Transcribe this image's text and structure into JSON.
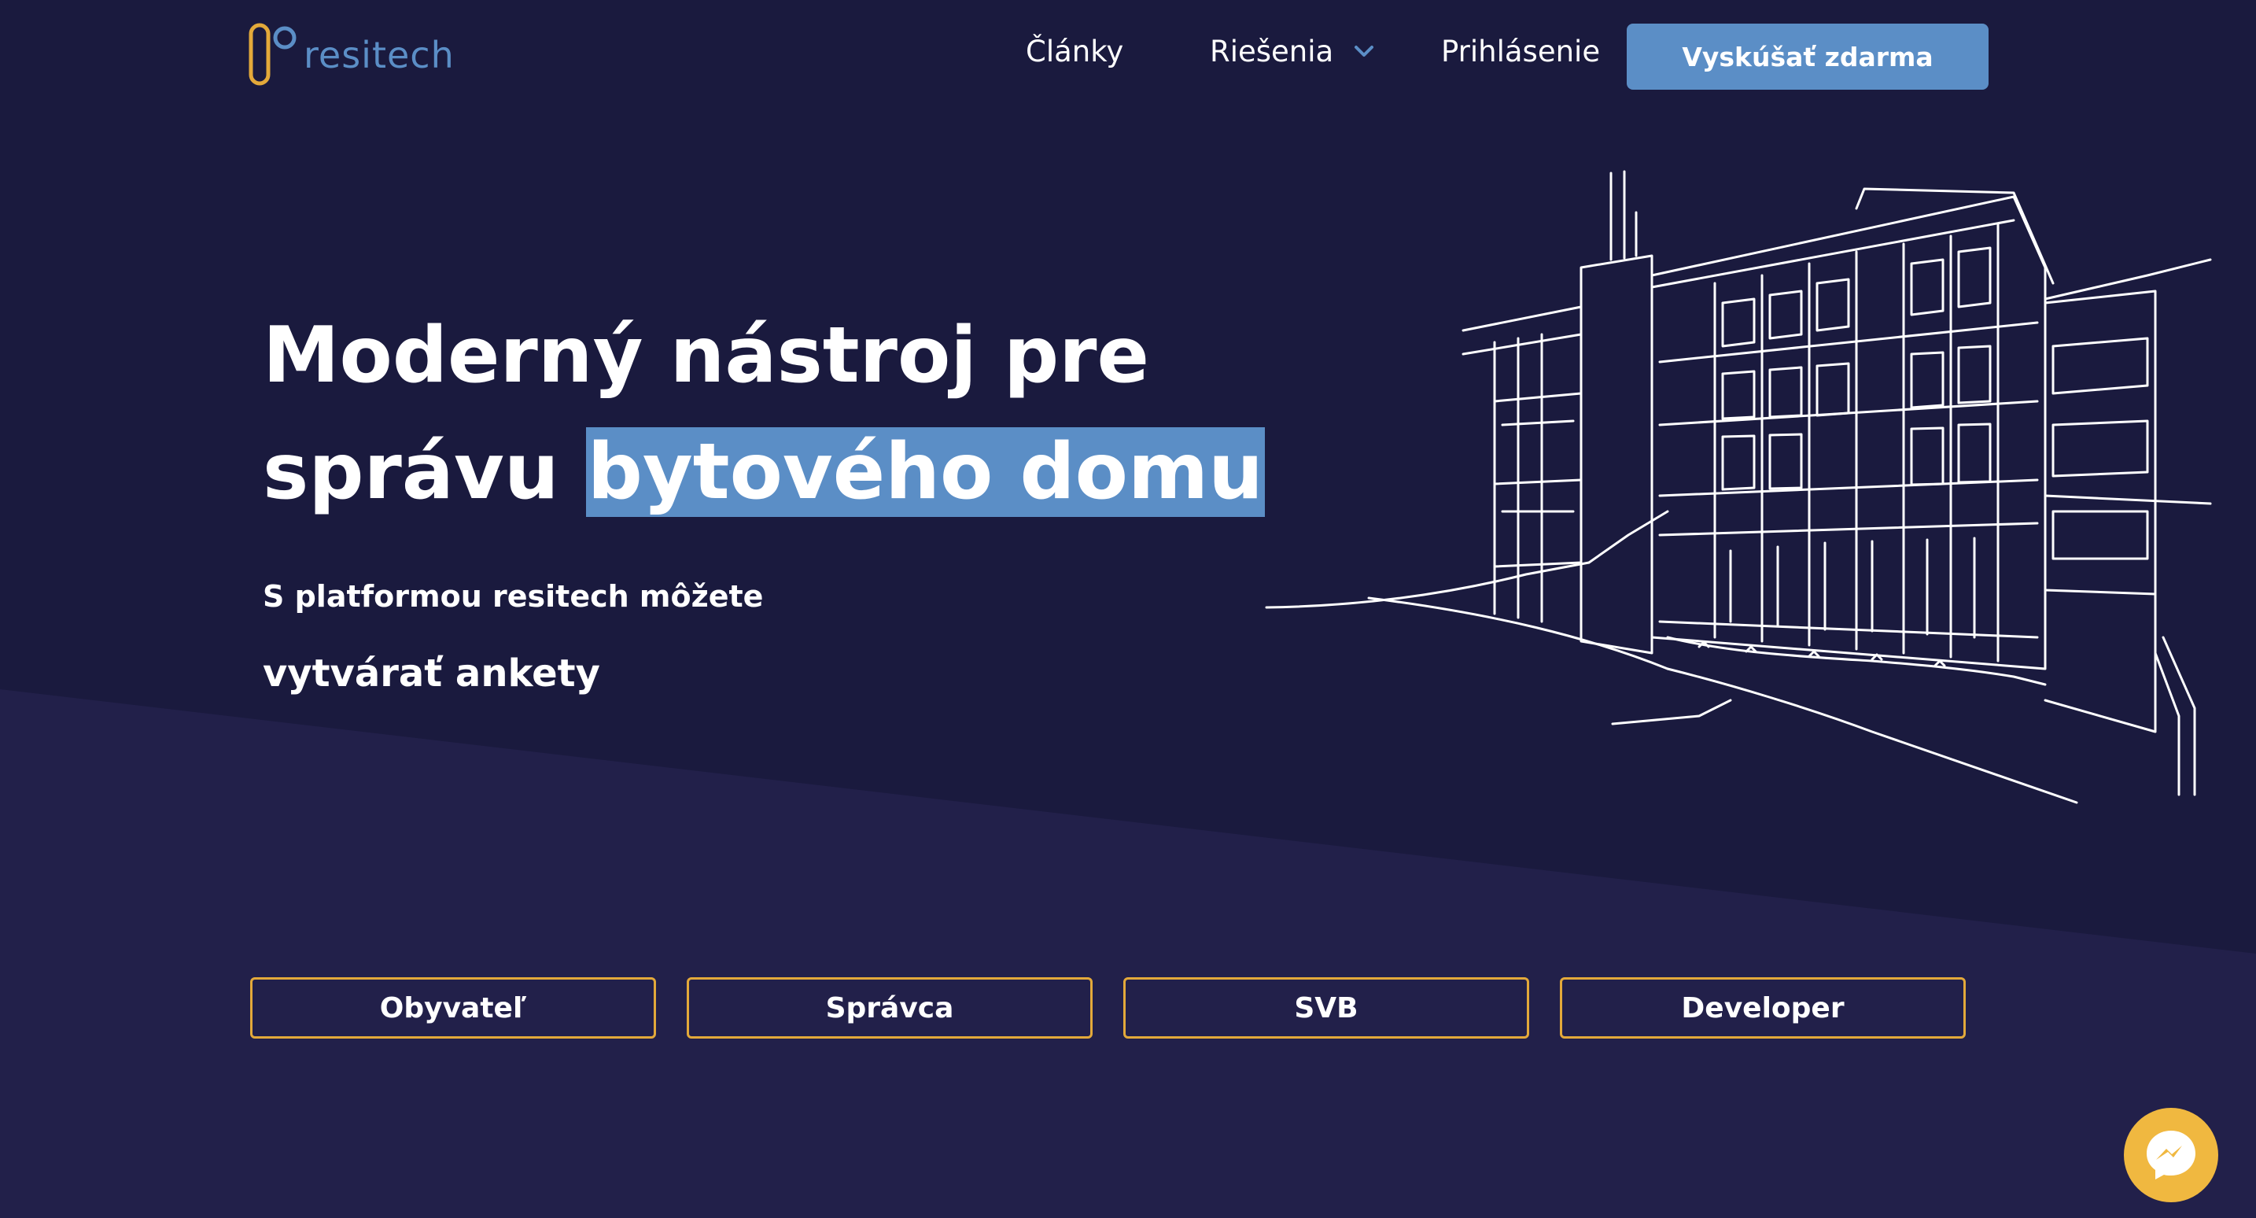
{
  "brand": {
    "name": "resitech",
    "accent": "#5b8ec6",
    "logo_accent": "#e3a93a"
  },
  "nav": {
    "articles": "Články",
    "solutions": "Riešenia",
    "login": "Prihlásenie",
    "cta": "Vyskúšať zdarma"
  },
  "hero": {
    "title_line1": "Moderný nástroj pre",
    "title_line2_plain": "správu ",
    "title_line2_highlight": "bytového domu",
    "subtitle": "S platformou resitech môžete",
    "feature": "vytvárať ankety"
  },
  "audiences": [
    "Obyvateľ",
    "Správca",
    "SVB",
    "Developer"
  ],
  "colors": {
    "background": "#1a1a3e",
    "background_lower": "#22204a",
    "button_border": "#e3a93a",
    "messenger": "#f0b840"
  },
  "icons": {
    "dropdown": "chevron-down-icon",
    "chat": "messenger-icon",
    "illustration": "building-sketch"
  }
}
